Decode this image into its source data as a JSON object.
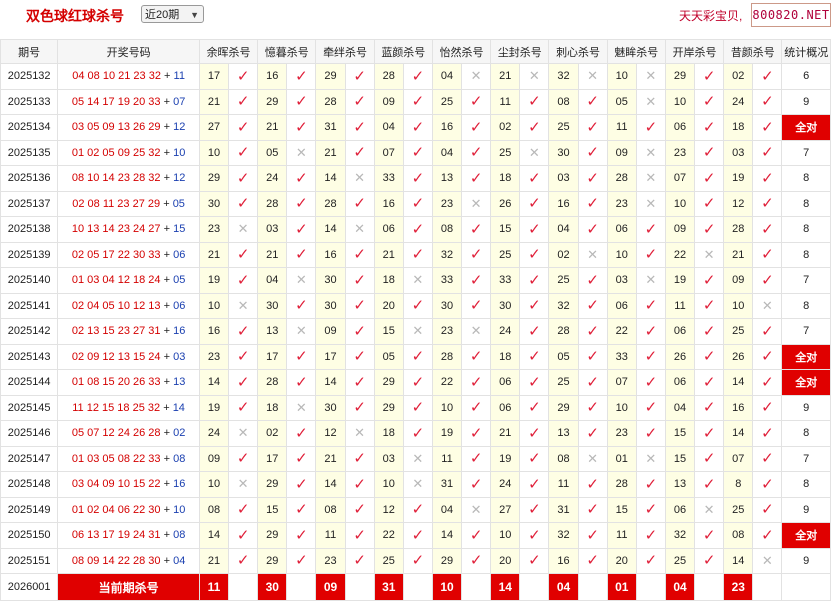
{
  "header": {
    "title": "双色球红球杀号",
    "period_select": "近20期",
    "site_name": "天天彩宝贝,",
    "site_url": "800820.NET"
  },
  "table": {
    "columns": [
      "期号",
      "开奖号码",
      "余晖杀号",
      "憶暮杀号",
      "牵绊杀号",
      "蓝颜杀号",
      "怡然杀号",
      "尘封杀号",
      "刺心杀号",
      "魅眸杀号",
      "开岸杀号",
      "昔颜杀号",
      "统计概况"
    ],
    "rows": [
      {
        "issue": "2025132",
        "reds": "04 08 10 21 23 32",
        "blue": "11",
        "kills": [
          [
            "17",
            true
          ],
          [
            "16",
            true
          ],
          [
            "29",
            true
          ],
          [
            "28",
            true
          ],
          [
            "04",
            false
          ],
          [
            "21",
            false
          ],
          [
            "32",
            false
          ],
          [
            "10",
            false
          ],
          [
            "29",
            true
          ],
          [
            "02",
            true
          ]
        ],
        "stat": "6"
      },
      {
        "issue": "2025133",
        "reds": "05 14 17 19 20 33",
        "blue": "07",
        "kills": [
          [
            "21",
            true
          ],
          [
            "29",
            true
          ],
          [
            "28",
            true
          ],
          [
            "09",
            true
          ],
          [
            "25",
            true
          ],
          [
            "11",
            true
          ],
          [
            "08",
            true
          ],
          [
            "05",
            false
          ],
          [
            "10",
            true
          ],
          [
            "24",
            true
          ]
        ],
        "stat": "9"
      },
      {
        "issue": "2025134",
        "reds": "03 05 09 13 26 29",
        "blue": "12",
        "kills": [
          [
            "27",
            true
          ],
          [
            "21",
            true
          ],
          [
            "31",
            true
          ],
          [
            "04",
            true
          ],
          [
            "16",
            true
          ],
          [
            "02",
            true
          ],
          [
            "25",
            true
          ],
          [
            "11",
            true
          ],
          [
            "06",
            true
          ],
          [
            "18",
            true
          ]
        ],
        "stat": "全对"
      },
      {
        "issue": "2025135",
        "reds": "01 02 05 09 25 32",
        "blue": "10",
        "kills": [
          [
            "10",
            true
          ],
          [
            "05",
            false
          ],
          [
            "21",
            true
          ],
          [
            "07",
            true
          ],
          [
            "04",
            true
          ],
          [
            "25",
            false
          ],
          [
            "30",
            true
          ],
          [
            "09",
            false
          ],
          [
            "23",
            true
          ],
          [
            "03",
            true
          ]
        ],
        "stat": "7"
      },
      {
        "issue": "2025136",
        "reds": "08 10 14 23 28 32",
        "blue": "12",
        "kills": [
          [
            "29",
            true
          ],
          [
            "24",
            true
          ],
          [
            "14",
            false
          ],
          [
            "33",
            true
          ],
          [
            "13",
            true
          ],
          [
            "18",
            true
          ],
          [
            "03",
            true
          ],
          [
            "28",
            false
          ],
          [
            "07",
            true
          ],
          [
            "19",
            true
          ]
        ],
        "stat": "8"
      },
      {
        "issue": "2025137",
        "reds": "02 08 11 23 27 29",
        "blue": "05",
        "kills": [
          [
            "30",
            true
          ],
          [
            "28",
            true
          ],
          [
            "28",
            true
          ],
          [
            "16",
            true
          ],
          [
            "23",
            false
          ],
          [
            "26",
            true
          ],
          [
            "16",
            true
          ],
          [
            "23",
            false
          ],
          [
            "10",
            true
          ],
          [
            "12",
            true
          ]
        ],
        "stat": "8"
      },
      {
        "issue": "2025138",
        "reds": "10 13 14 23 24 27",
        "blue": "15",
        "kills": [
          [
            "23",
            false
          ],
          [
            "03",
            true
          ],
          [
            "14",
            false
          ],
          [
            "06",
            true
          ],
          [
            "08",
            true
          ],
          [
            "15",
            true
          ],
          [
            "04",
            true
          ],
          [
            "06",
            true
          ],
          [
            "09",
            true
          ],
          [
            "28",
            true
          ]
        ],
        "stat": "8"
      },
      {
        "issue": "2025139",
        "reds": "02 05 17 22 30 33",
        "blue": "06",
        "kills": [
          [
            "21",
            true
          ],
          [
            "21",
            true
          ],
          [
            "16",
            true
          ],
          [
            "21",
            true
          ],
          [
            "32",
            true
          ],
          [
            "25",
            true
          ],
          [
            "02",
            false
          ],
          [
            "10",
            true
          ],
          [
            "22",
            false
          ],
          [
            "21",
            true
          ]
        ],
        "stat": "8"
      },
      {
        "issue": "2025140",
        "reds": "01 03 04 12 18 24",
        "blue": "05",
        "kills": [
          [
            "19",
            true
          ],
          [
            "04",
            false
          ],
          [
            "30",
            true
          ],
          [
            "18",
            false
          ],
          [
            "33",
            true
          ],
          [
            "33",
            true
          ],
          [
            "25",
            true
          ],
          [
            "03",
            false
          ],
          [
            "19",
            true
          ],
          [
            "09",
            true
          ]
        ],
        "stat": "7"
      },
      {
        "issue": "2025141",
        "reds": "02 04 05 10 12 13",
        "blue": "06",
        "kills": [
          [
            "10",
            false
          ],
          [
            "30",
            true
          ],
          [
            "30",
            true
          ],
          [
            "20",
            true
          ],
          [
            "30",
            true
          ],
          [
            "30",
            true
          ],
          [
            "32",
            true
          ],
          [
            "06",
            true
          ],
          [
            "11",
            true
          ],
          [
            "10",
            false
          ]
        ],
        "stat": "8"
      },
      {
        "issue": "2025142",
        "reds": "02 13 15 23 27 31",
        "blue": "16",
        "kills": [
          [
            "16",
            true
          ],
          [
            "13",
            false
          ],
          [
            "09",
            true
          ],
          [
            "15",
            false
          ],
          [
            "23",
            false
          ],
          [
            "24",
            true
          ],
          [
            "28",
            true
          ],
          [
            "22",
            true
          ],
          [
            "06",
            true
          ],
          [
            "25",
            true
          ]
        ],
        "stat": "7"
      },
      {
        "issue": "2025143",
        "reds": "02 09 12 13 15 24",
        "blue": "03",
        "kills": [
          [
            "23",
            true
          ],
          [
            "17",
            true
          ],
          [
            "17",
            true
          ],
          [
            "05",
            true
          ],
          [
            "28",
            true
          ],
          [
            "18",
            true
          ],
          [
            "05",
            true
          ],
          [
            "33",
            true
          ],
          [
            "26",
            true
          ],
          [
            "26",
            true
          ]
        ],
        "stat": "全对"
      },
      {
        "issue": "2025144",
        "reds": "01 08 15 20 26 33",
        "blue": "13",
        "kills": [
          [
            "14",
            true
          ],
          [
            "28",
            true
          ],
          [
            "14",
            true
          ],
          [
            "29",
            true
          ],
          [
            "22",
            true
          ],
          [
            "06",
            true
          ],
          [
            "25",
            true
          ],
          [
            "07",
            true
          ],
          [
            "06",
            true
          ],
          [
            "14",
            true
          ]
        ],
        "stat": "全对"
      },
      {
        "issue": "2025145",
        "reds": "11 12 15 18 25 32",
        "blue": "14",
        "kills": [
          [
            "19",
            true
          ],
          [
            "18",
            false
          ],
          [
            "30",
            true
          ],
          [
            "29",
            true
          ],
          [
            "10",
            true
          ],
          [
            "06",
            true
          ],
          [
            "29",
            true
          ],
          [
            "10",
            true
          ],
          [
            "04",
            true
          ],
          [
            "16",
            true
          ]
        ],
        "stat": "9"
      },
      {
        "issue": "2025146",
        "reds": "05 07 12 24 26 28",
        "blue": "02",
        "kills": [
          [
            "24",
            false
          ],
          [
            "02",
            true
          ],
          [
            "12",
            false
          ],
          [
            "18",
            true
          ],
          [
            "19",
            true
          ],
          [
            "21",
            true
          ],
          [
            "13",
            true
          ],
          [
            "23",
            true
          ],
          [
            "15",
            true
          ],
          [
            "14",
            true
          ]
        ],
        "stat": "8"
      },
      {
        "issue": "2025147",
        "reds": "01 03 05 08 22 33",
        "blue": "08",
        "kills": [
          [
            "09",
            true
          ],
          [
            "17",
            true
          ],
          [
            "21",
            true
          ],
          [
            "03",
            false
          ],
          [
            "11",
            true
          ],
          [
            "19",
            true
          ],
          [
            "08",
            false
          ],
          [
            "01",
            false
          ],
          [
            "15",
            true
          ],
          [
            "07",
            true
          ]
        ],
        "stat": "7"
      },
      {
        "issue": "2025148",
        "reds": "03 04 09 10 15 22",
        "blue": "16",
        "kills": [
          [
            "10",
            false
          ],
          [
            "29",
            true
          ],
          [
            "14",
            true
          ],
          [
            "10",
            false
          ],
          [
            "31",
            true
          ],
          [
            "24",
            true
          ],
          [
            "11",
            true
          ],
          [
            "28",
            true
          ],
          [
            "13",
            true
          ],
          [
            "8",
            true
          ]
        ],
        "stat": "8"
      },
      {
        "issue": "2025149",
        "reds": "01 02 04 06 22 30",
        "blue": "10",
        "kills": [
          [
            "08",
            true
          ],
          [
            "15",
            true
          ],
          [
            "08",
            true
          ],
          [
            "12",
            true
          ],
          [
            "04",
            false
          ],
          [
            "27",
            true
          ],
          [
            "31",
            true
          ],
          [
            "15",
            true
          ],
          [
            "06",
            false
          ],
          [
            "25",
            true
          ]
        ],
        "stat": "9"
      },
      {
        "issue": "2025150",
        "reds": "06 13 17 19 24 31",
        "blue": "08",
        "kills": [
          [
            "14",
            true
          ],
          [
            "29",
            true
          ],
          [
            "11",
            true
          ],
          [
            "22",
            true
          ],
          [
            "14",
            true
          ],
          [
            "10",
            true
          ],
          [
            "32",
            true
          ],
          [
            "11",
            true
          ],
          [
            "32",
            true
          ],
          [
            "08",
            true
          ]
        ],
        "stat": "全对"
      },
      {
        "issue": "2025151",
        "reds": "08 09 14 22 28 30",
        "blue": "04",
        "kills": [
          [
            "21",
            true
          ],
          [
            "29",
            true
          ],
          [
            "23",
            true
          ],
          [
            "25",
            true
          ],
          [
            "29",
            true
          ],
          [
            "20",
            true
          ],
          [
            "16",
            true
          ],
          [
            "20",
            true
          ],
          [
            "25",
            true
          ],
          [
            "14",
            false
          ]
        ],
        "stat": "9"
      }
    ],
    "current": {
      "issue": "2026001",
      "label": "当前期杀号",
      "kills": [
        "11",
        "30",
        "09",
        "31",
        "10",
        "14",
        "04",
        "01",
        "04",
        "23"
      ]
    }
  },
  "colors": {
    "red": "#d40000",
    "blue": "#1a3fb0",
    "tick": "#e0203a",
    "full_bg": "#e00000",
    "num_bg": "#fefee4"
  }
}
